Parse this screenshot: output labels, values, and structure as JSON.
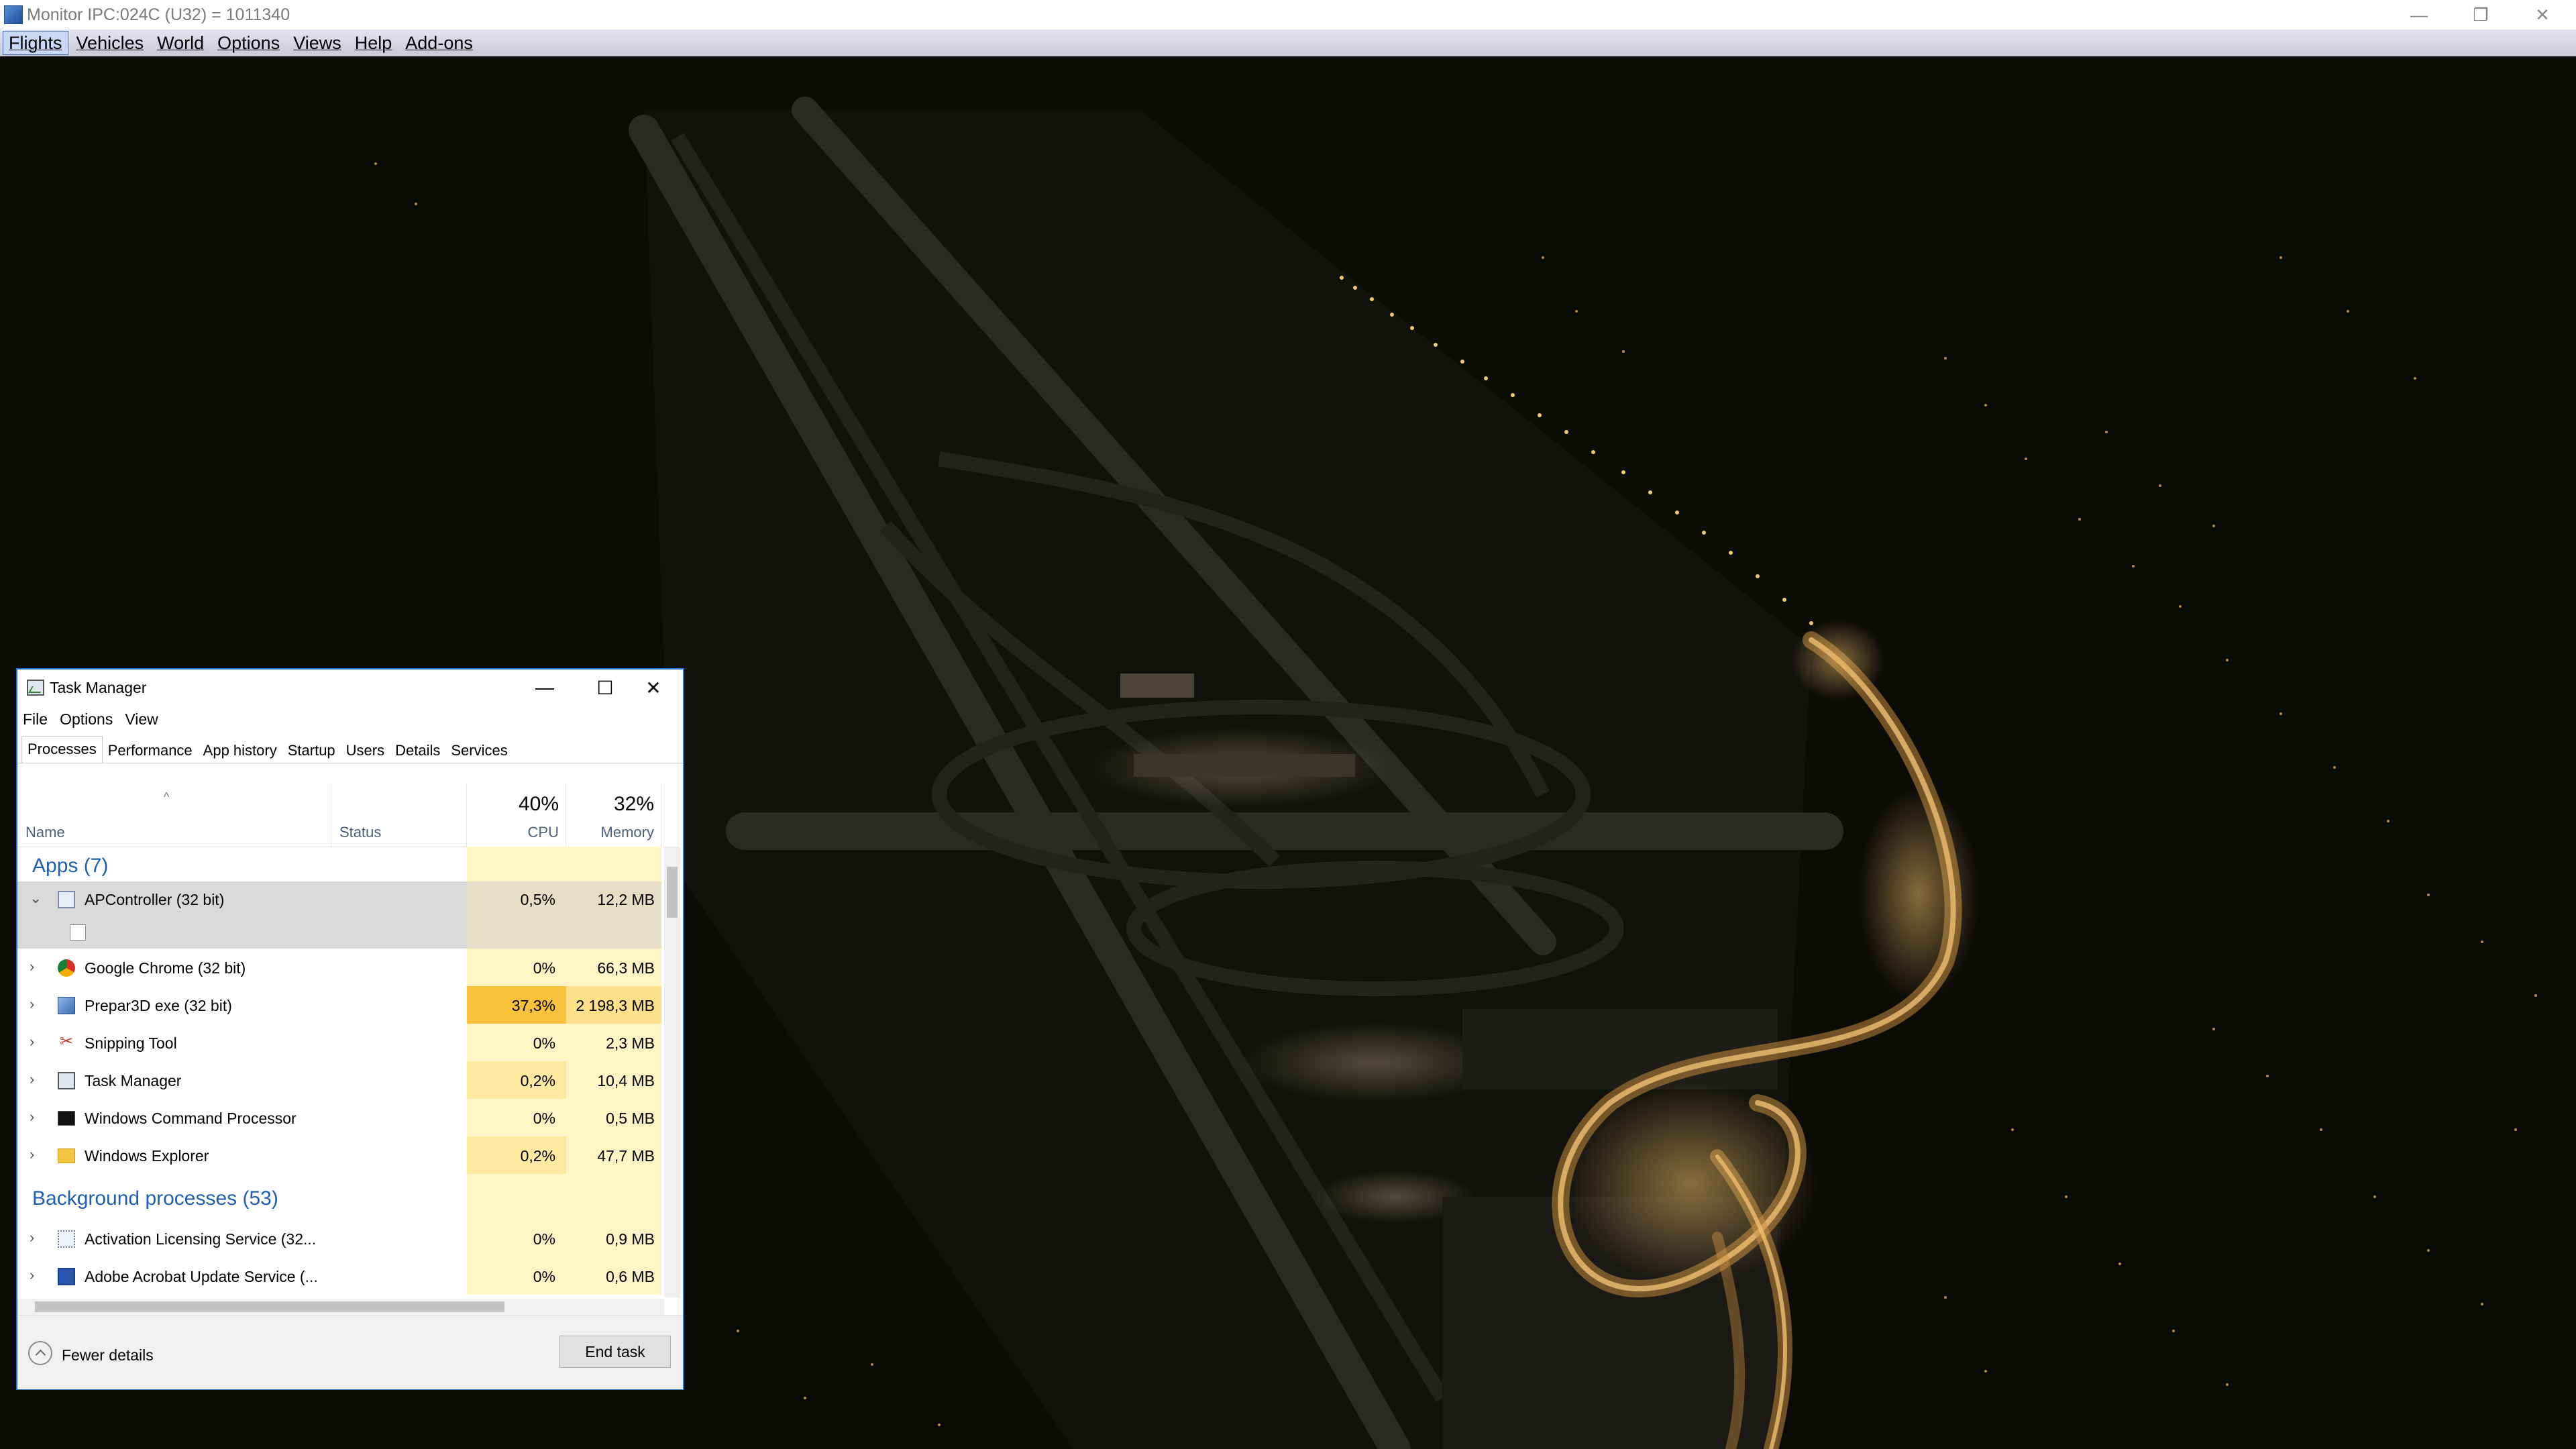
{
  "window": {
    "title": "Monitor IPC:024C (U32) = 1011340",
    "controls": {
      "minimize": "—",
      "restore": "❐",
      "close": "✕"
    }
  },
  "menubar": {
    "items": [
      "Flights",
      "Vehicles",
      "World",
      "Options",
      "Views",
      "Help",
      "Add-ons"
    ]
  },
  "task_manager": {
    "title": "Task Manager",
    "controls": {
      "minimize": "—",
      "maximize": "☐",
      "close": "✕"
    },
    "menu": [
      "File",
      "Options",
      "View"
    ],
    "tabs": [
      "Processes",
      "Performance",
      "App history",
      "Startup",
      "Users",
      "Details",
      "Services"
    ],
    "columns": {
      "name": "Name",
      "status": "Status",
      "cpu_pct": "40%",
      "cpu": "CPU",
      "mem_pct": "32%",
      "memory": "Memory",
      "sort_caret": "^"
    },
    "groups": {
      "apps": "Apps (7)",
      "background": "Background processes (53)"
    },
    "apps": [
      {
        "name": "APController (32 bit)",
        "cpu": "0,5%",
        "memory": "12,2 MB",
        "icon": "apcontroller-icon",
        "expanded": true
      },
      {
        "name": "Google Chrome (32 bit)",
        "cpu": "0%",
        "memory": "66,3 MB",
        "icon": "chrome-icon"
      },
      {
        "name": "Prepar3D exe (32 bit)",
        "cpu": "37,3%",
        "memory": "2 198,3 MB",
        "icon": "prepar3d-icon"
      },
      {
        "name": "Snipping Tool",
        "cpu": "0%",
        "memory": "2,3 MB",
        "icon": "scissors-icon"
      },
      {
        "name": "Task Manager",
        "cpu": "0,2%",
        "memory": "10,4 MB",
        "icon": "task-manager-icon"
      },
      {
        "name": "Windows Command Processor",
        "cpu": "0%",
        "memory": "0,5 MB",
        "icon": "cmd-icon"
      },
      {
        "name": "Windows Explorer",
        "cpu": "0,2%",
        "memory": "47,7 MB",
        "icon": "folder-icon"
      }
    ],
    "background": [
      {
        "name": "Activation Licensing Service (32...",
        "cpu": "0%",
        "memory": "0,9 MB",
        "icon": "service-icon"
      },
      {
        "name": "Adobe Acrobat Update Service (...",
        "cpu": "0%",
        "memory": "0,6 MB",
        "icon": "service-icon"
      }
    ],
    "footer": {
      "fewer_details": "Fewer details",
      "end_task": "End task"
    },
    "colors": {
      "cpu_light": "#fff4c4",
      "cpu_mid": "#ffe9a0",
      "cpu_hot": "#f9c23c",
      "mem_light": "#fff4c4",
      "accent": "#1b75d0",
      "group_text": "#1f5fb0"
    }
  }
}
